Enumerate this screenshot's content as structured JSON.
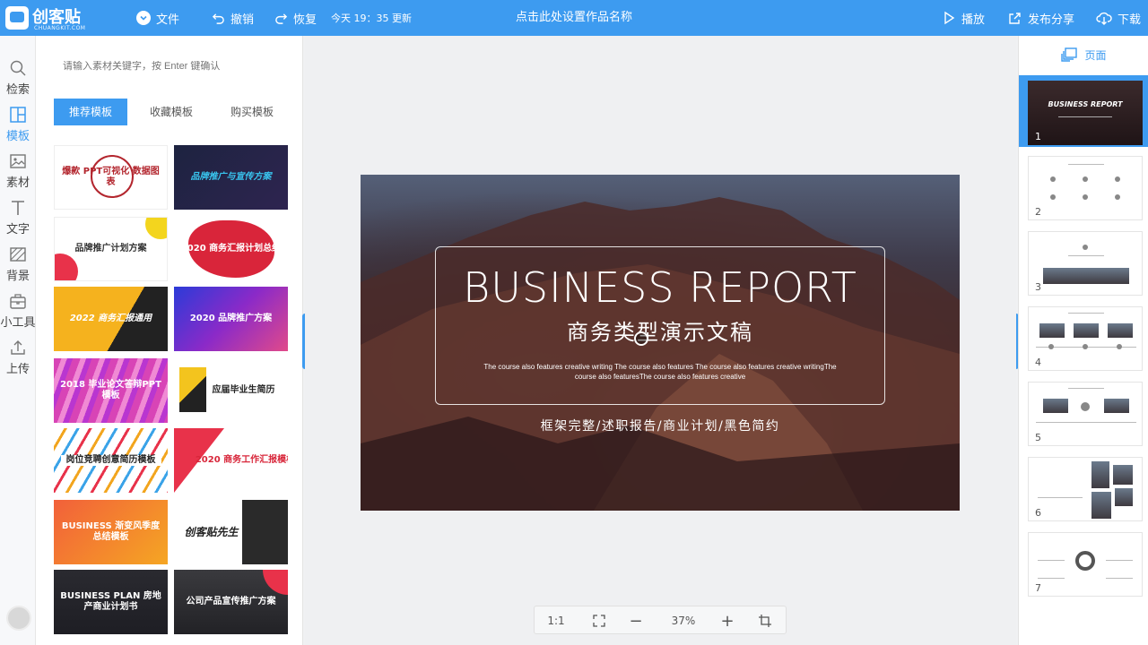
{
  "topbar": {
    "logo_text": "创客贴",
    "logo_sub": "CHUANGKIT.COM",
    "file_label": "文件",
    "undo_label": "撤销",
    "redo_label": "恢复",
    "updated_text": "今天 19：35 更新",
    "title": "点击此处设置作品名称",
    "play_label": "播放",
    "share_label": "发布分享",
    "download_label": "下载"
  },
  "leftnav": {
    "items": [
      {
        "label": "检索",
        "icon": "search-icon"
      },
      {
        "label": "模板",
        "icon": "template-icon"
      },
      {
        "label": "素材",
        "icon": "image-icon"
      },
      {
        "label": "文字",
        "icon": "text-icon"
      },
      {
        "label": "背景",
        "icon": "background-icon"
      },
      {
        "label": "小工具",
        "icon": "toolbox-icon"
      },
      {
        "label": "上传",
        "icon": "upload-icon"
      }
    ],
    "active_index": 1
  },
  "panel": {
    "search_placeholder": "请输入素材关键字，按 Enter 键确认",
    "tabs": [
      "推荐模板",
      "收藏模板",
      "购买模板"
    ],
    "active_tab": 0,
    "templates": [
      {
        "text": "爆款 PPT可视化 数据图表",
        "bg": "#ffffff",
        "fg": "#b3262e"
      },
      {
        "text": "品牌推广与宣传方案",
        "bg": "#1d2340",
        "fg": "#39c6f0"
      },
      {
        "text": "品牌推广计划方案",
        "bg": "#ffffff",
        "fg": "#333333"
      },
      {
        "text": "2020 商务汇报计划总结",
        "bg": "#ffffff",
        "fg": "#ffffff"
      },
      {
        "text": "2022 商务汇报通用",
        "bg": "#f5b21e",
        "fg": "#ffffff"
      },
      {
        "text": "2020 品牌推广方案",
        "bg": "#3a3fc8",
        "fg": "#ffffff"
      },
      {
        "text": "2018 毕业论文答辩PPT模板",
        "bg": "#d844b6",
        "fg": "#ffffff"
      },
      {
        "text": "应届毕业生简历",
        "bg": "#ffffff",
        "fg": "#222222"
      },
      {
        "text": "岗位竞聘创意简历模板",
        "bg": "#ffffff",
        "fg": "#222222"
      },
      {
        "text": "2020 商务工作汇报模板",
        "bg": "#ffffff",
        "fg": "#d8263a"
      },
      {
        "text": "BUSINESS 渐变风季度总结模板",
        "bg": "#f2603a",
        "fg": "#ffffff"
      },
      {
        "text": "创客贴先生",
        "bg": "#ffffff",
        "fg": "#222222"
      },
      {
        "text": "BUSINESS PLAN 房地产商业计划书",
        "bg": "#1e1e24",
        "fg": "#ffffff"
      },
      {
        "text": "公司产品宣传推广方案",
        "bg": "#2a2a2e",
        "fg": "#ffffff"
      }
    ]
  },
  "slide": {
    "title": "BUSINESS REPORT",
    "subtitle": "商务类型演示文稿",
    "description": "The course also features creative writing The course also features The course also features creative writingThe course also featuresThe course also features creative",
    "tags": "框架完整/述职报告/商业计划/黑色简约"
  },
  "zoombar": {
    "ratio_label": "1:1",
    "zoom": "37%",
    "minus_label": "−",
    "plus_label": "+"
  },
  "pages": {
    "header": "页面",
    "items": [
      {
        "num": "1",
        "title": "BUSINESS REPORT"
      },
      {
        "num": "2"
      },
      {
        "num": "3"
      },
      {
        "num": "4"
      },
      {
        "num": "5"
      },
      {
        "num": "6"
      },
      {
        "num": "7"
      }
    ],
    "active_index": 0
  },
  "colors": {
    "accent": "#3d9bf0",
    "panel_bg": "#ffffff",
    "canvas_bg": "#eff0f2"
  }
}
